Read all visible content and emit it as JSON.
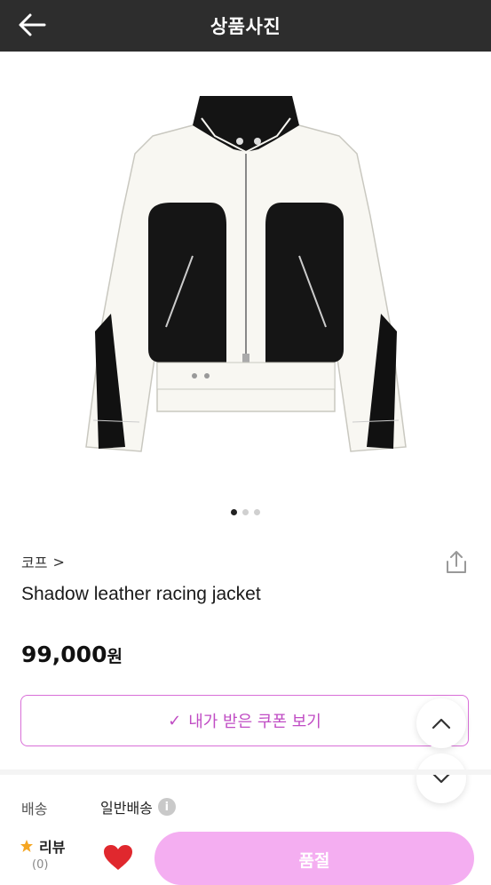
{
  "header": {
    "title": "상품사진",
    "back_icon": "arrow-left-icon"
  },
  "carousel": {
    "image_alt": "Shadow leather racing jacket",
    "total_slides": 3,
    "active_index": 0
  },
  "product": {
    "brand": "코프",
    "brand_chevron": ">",
    "name": "Shadow leather racing jacket",
    "price": "99,000",
    "currency": "원"
  },
  "coupon": {
    "label": "내가 받은 쿠폰 보기",
    "check_icon": "✓"
  },
  "shipping": {
    "label": "배송",
    "value": "일반배송",
    "info_icon": "i"
  },
  "bottom_bar": {
    "review_label": "리뷰",
    "review_count": "(0)",
    "buy_label": "품절"
  },
  "colors": {
    "header_bg": "#2d2d2d",
    "accent": "#c04cc4",
    "coupon_border": "#d96fd8",
    "buy_button": "#f4aef1",
    "heart": "#e0282e",
    "star": "#f5a623"
  }
}
